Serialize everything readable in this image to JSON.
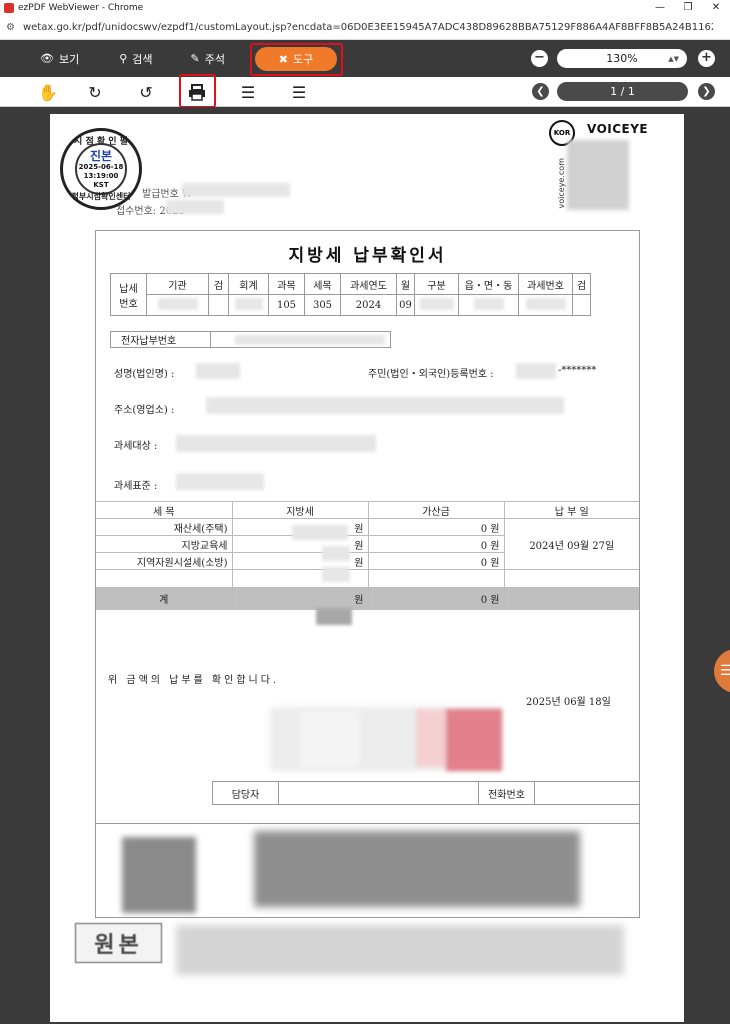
{
  "window": {
    "title": "ezPDF WebViewer - Chrome",
    "url": "wetax.go.kr/pdf/unidocswv/ezpdf1/customLayout.jsp?encdata=06D0E3EE15945A7ADC438D89628BBA75129F886A4AF8BFF8B5A24B1162946..."
  },
  "toolbar": {
    "view": "보기",
    "search": "검색",
    "annotate": "주석",
    "tools": "도구",
    "zoom": "130%",
    "page": "1 / 1"
  },
  "seal": {
    "top": "시 점 확 인 필",
    "center": "진본",
    "date": "2025-06-18",
    "time": "13:19:00",
    "zone": "KST",
    "bottom": "정부시점확인센터"
  },
  "doc_meta": {
    "line1": "발급번호 W",
    "line2": "접수번호: 2025"
  },
  "voiceye": {
    "brand": "VOICEYE",
    "kor": "KOR",
    "site": "voiceye.com"
  },
  "form": {
    "title": "지방세 납부확인서",
    "tax_headers": [
      "납세\n번호",
      "기관",
      "검",
      "회계",
      "과목",
      "세목",
      "과세연도",
      "월",
      "구분",
      "읍・면・동",
      "과세번호",
      "검"
    ],
    "tax_values": [
      "",
      "",
      "",
      "105",
      "305",
      "2024",
      "09",
      "",
      "",
      "",
      ""
    ],
    "epay_label": "전자납부번호",
    "name_label": "성명(법인명) :",
    "id_label": "주민(법인・외국인)등록번호 :",
    "id_masked": "-*******",
    "address_label": "주소(영업소) :",
    "object_label": "과세대상 :",
    "standard_label": "과세표준 :",
    "amount_headers": [
      "세 목",
      "지방세",
      "가산금",
      "납 부 일"
    ],
    "rows": [
      {
        "item": "재산세(주택)",
        "unit": "원",
        "penalty": "0 원"
      },
      {
        "item": "지방교육세",
        "unit": "원",
        "penalty": "0 원"
      },
      {
        "item": "지역자원시설세(소방)",
        "unit": "원",
        "penalty": "0 원"
      }
    ],
    "pay_date": "2024년 09월 27일",
    "total_label": "계",
    "total_unit": "원",
    "total_penalty": "0 원",
    "confirm": "위 금액의 납부를 확인합니다.",
    "issue_date": "2025년 06월 18일",
    "contact_person": "담당자",
    "contact_phone": "전화번호"
  },
  "original_mark": "원본"
}
